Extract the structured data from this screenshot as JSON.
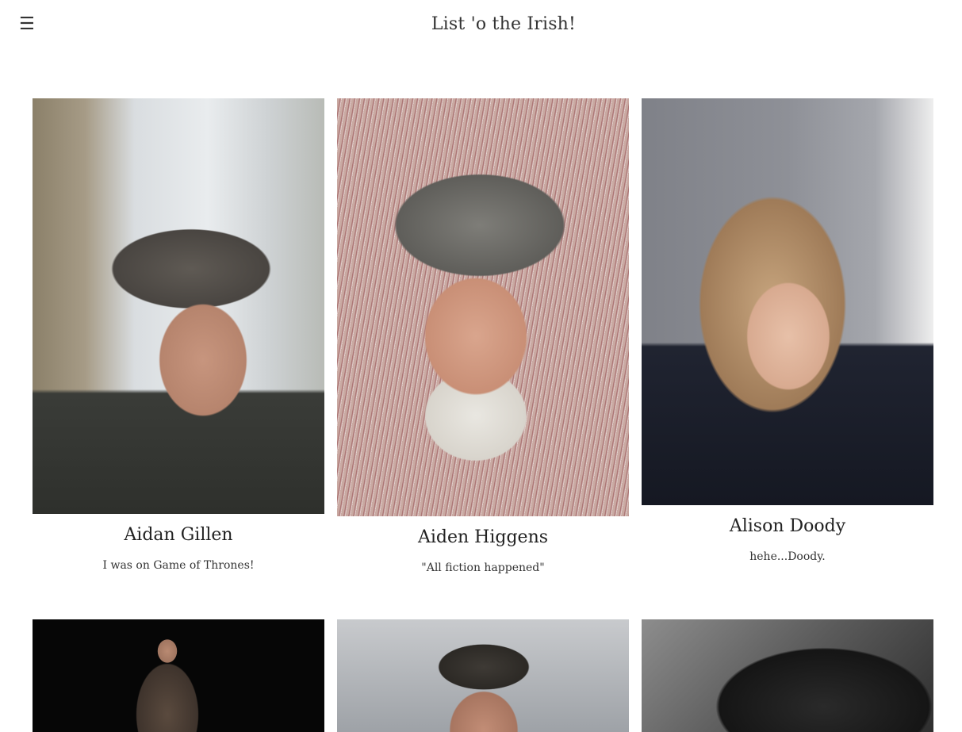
{
  "header": {
    "menu_icon": "☰",
    "title": "List 'o the Irish!"
  },
  "cards": [
    {
      "name": "Aidan Gillen",
      "quote": "I was on Game of Thrones!"
    },
    {
      "name": "Aiden Higgens",
      "quote": "\"All fiction happened\""
    },
    {
      "name": "Alison Doody",
      "quote": "hehe...Doody."
    },
    {
      "name": "",
      "quote": ""
    },
    {
      "name": "",
      "quote": ""
    },
    {
      "name": "",
      "quote": ""
    }
  ]
}
